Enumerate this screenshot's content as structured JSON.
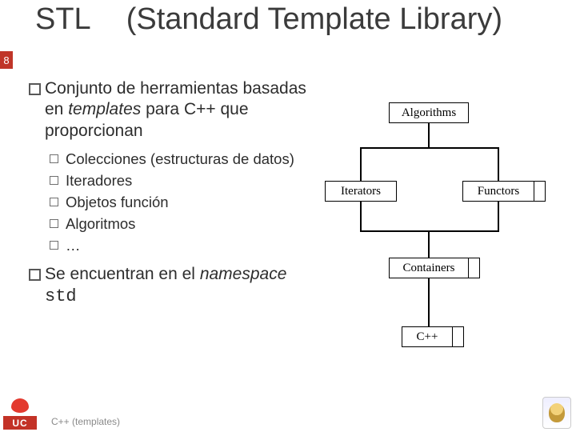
{
  "page_number": "8",
  "title_a": "STL",
  "title_b": "(Standard Template Library)",
  "para1_a": "Conjunto de herramientas basadas en ",
  "para1_b": "templates",
  "para1_c": " para C++ que proporcionan",
  "sub": {
    "s1": "Colecciones (estructuras de datos)",
    "s2": "Iteradores",
    "s3": "Objetos función",
    "s4": "Algoritmos",
    "s5": "…"
  },
  "para2_a": "Se encuentran en el ",
  "para2_b": "namespace",
  "para2_c": " ",
  "para2_d": "std",
  "diagram": {
    "algorithms": "Algorithms",
    "iterators": "Iterators",
    "functors": "Functors",
    "containers": "Containers",
    "cpp": "C++"
  },
  "logo_uc": "UC",
  "footer": "C++ (templates)",
  "chart_data": {
    "type": "diagram",
    "description": "Layered STL architecture diagram",
    "layers_top_to_bottom": [
      {
        "level": 4,
        "nodes": [
          "Algorithms"
        ]
      },
      {
        "level": 3,
        "nodes": [
          "Iterators",
          "Functors"
        ]
      },
      {
        "level": 2,
        "nodes": [
          "Containers"
        ]
      },
      {
        "level": 1,
        "nodes": [
          "C++"
        ]
      }
    ],
    "edges": [
      [
        "Algorithms",
        "Iterators"
      ],
      [
        "Algorithms",
        "Functors"
      ],
      [
        "Iterators",
        "Containers"
      ],
      [
        "Functors",
        "Containers"
      ],
      [
        "Containers",
        "C++"
      ]
    ]
  }
}
